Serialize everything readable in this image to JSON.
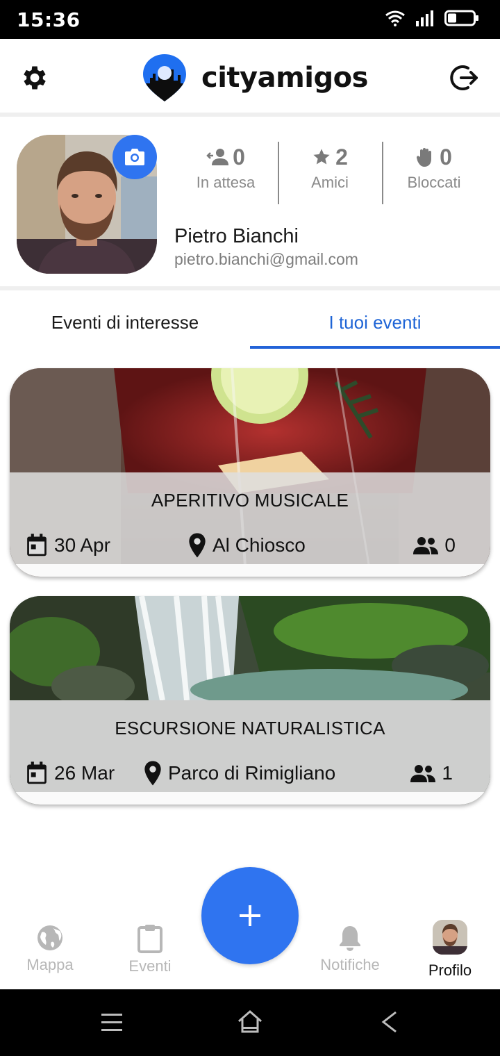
{
  "status_bar": {
    "time": "15:36"
  },
  "header": {
    "brand_name": "cityamigos"
  },
  "profile": {
    "name": "Pietro Bianchi",
    "email": "pietro.bianchi@gmail.com",
    "stats": [
      {
        "icon": "pending-user-icon",
        "value": "0",
        "label": "In attesa"
      },
      {
        "icon": "star-icon",
        "value": "2",
        "label": "Amici"
      },
      {
        "icon": "hand-icon",
        "value": "0",
        "label": "Bloccati"
      }
    ]
  },
  "tabs": [
    {
      "label": "Eventi di interesse",
      "active": false
    },
    {
      "label": "I tuoi eventi",
      "active": true
    }
  ],
  "events": [
    {
      "title": "APERITIVO MUSICALE",
      "date": "30 Apr",
      "place": "Al Chiosco",
      "participants": "0"
    },
    {
      "title": "ESCURSIONE NATURALISTICA",
      "date": "26 Mar",
      "place": "Parco di Rimigliano",
      "participants": "1"
    }
  ],
  "bottom_nav": [
    {
      "label": "Mappa",
      "icon": "globe-icon"
    },
    {
      "label": "Eventi",
      "icon": "clipboard-icon"
    },
    {
      "label": "Notifiche",
      "icon": "bell-icon"
    },
    {
      "label": "Profilo",
      "icon": "avatar"
    }
  ],
  "colors": {
    "accent": "#2f74f0",
    "tab_active": "#1e64d6"
  }
}
